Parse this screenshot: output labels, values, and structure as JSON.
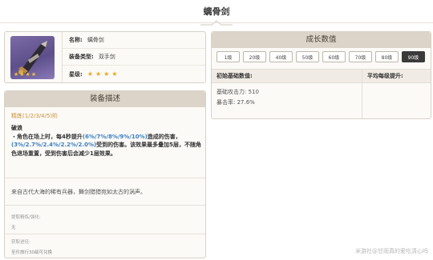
{
  "page": {
    "title": "螭骨剑"
  },
  "info": {
    "name_label": "名称:",
    "name_value": "螭骨剑",
    "type_label": "装备类型:",
    "type_value": "双手剑",
    "rarity_label": "星级:",
    "rarity_stars": "★★★★",
    "image_icon": "claymore-weapon-icon",
    "image_stars": "★★★★"
  },
  "description": {
    "header": "装备描述",
    "refine": "精炼(1/2/3/4/5)阶",
    "passive_name": "破浪",
    "passive_part1": "・角色在场上时，每4秒提升",
    "passive_hl1": "(6%/7%/8%/9%/10%)",
    "passive_part2": "造成的伤害，",
    "passive_hl2": "(3%/2.7%/2.4%/2.2%/2.0%)",
    "passive_part3": "受到的伤害。该效果最多叠加5层，不随角色退场重置，受到伤害后会减少1层效果。",
    "story": "来自古代大海的稀有兵器，舞剑猎猎宛如太古的涡声。",
    "refine_materials_label": "提取精炼/强化:",
    "refine_materials_value": "无",
    "source_label": "获取途径:",
    "source_value": "至珍旅行30级可兑换"
  },
  "growth": {
    "header": "成长数值",
    "levels": [
      "1级",
      "20级",
      "40级",
      "50级",
      "60级",
      "70级",
      "80级",
      "90级"
    ],
    "active_level": "90级",
    "col_base": "初始基础数值:",
    "col_growth": "平均每级提升:",
    "base_attack": "基础攻击力: 510",
    "crit_rate": "暴击率: 27.6%"
  },
  "watermark": "米游社@甘雨真的爱吃清心吗"
}
